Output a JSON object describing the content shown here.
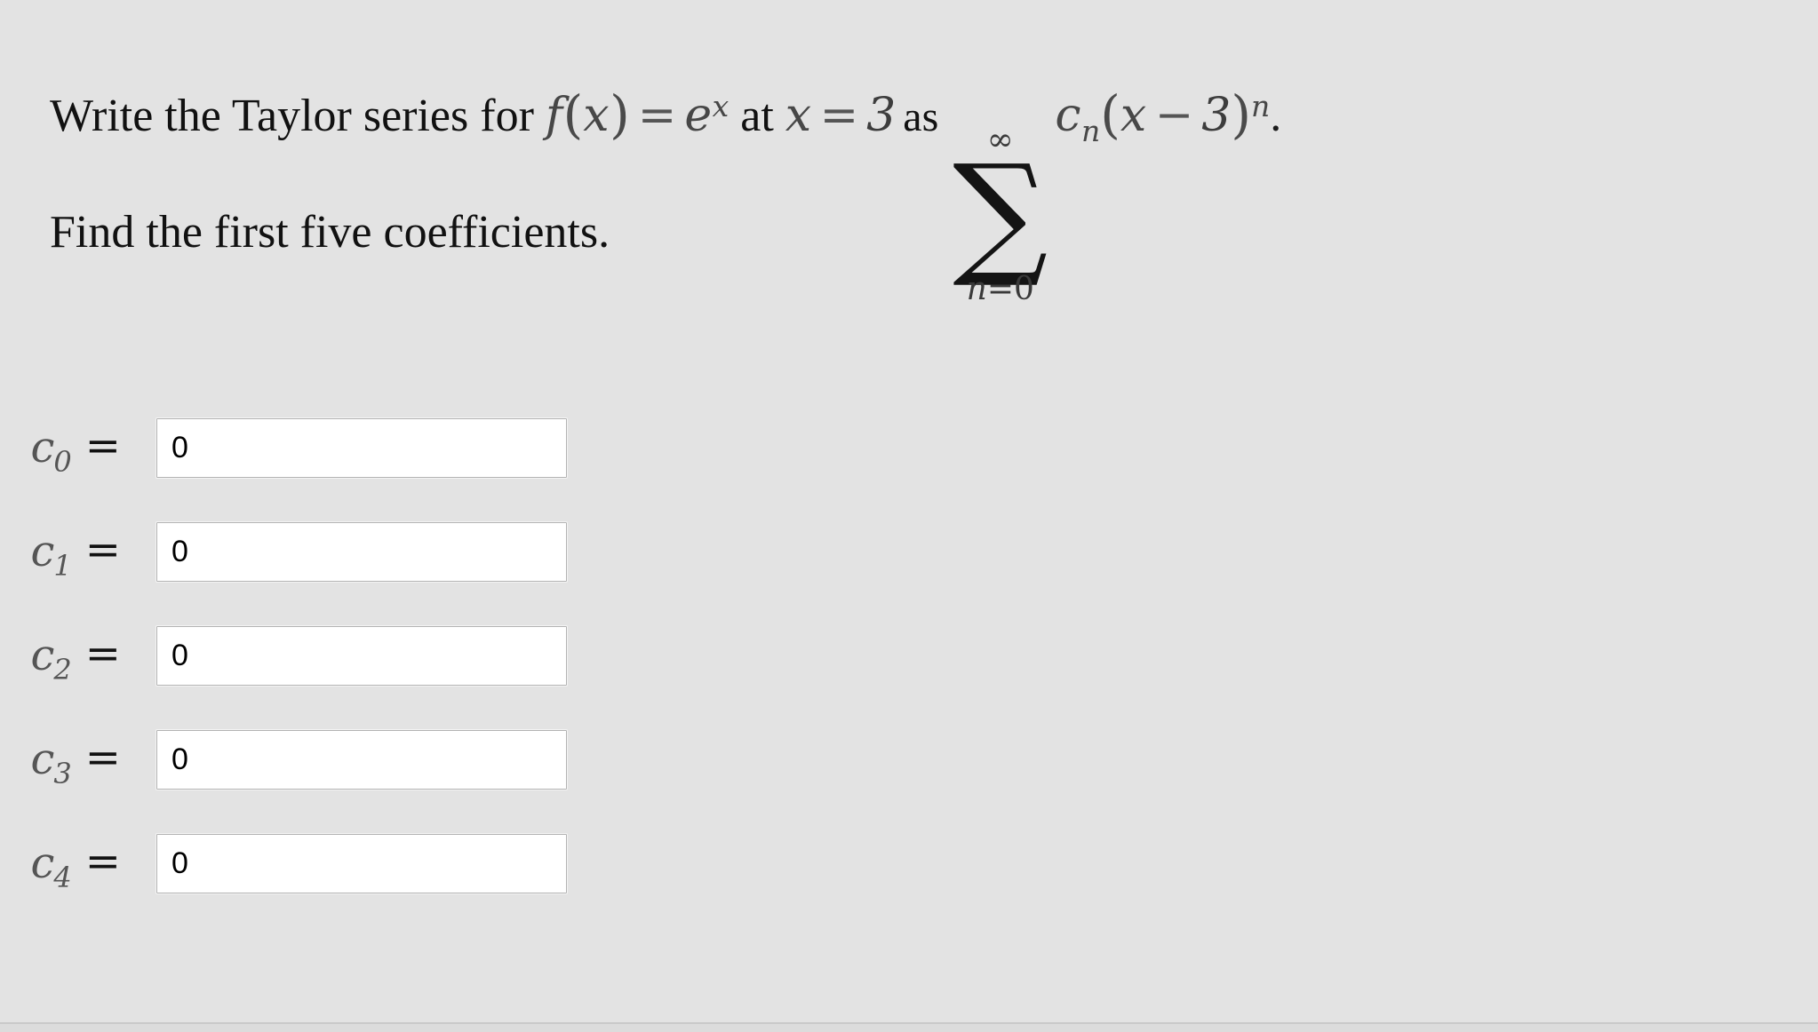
{
  "page": {
    "background_color": "#e3e3e3",
    "text_color": "#111111"
  },
  "problem": {
    "line1": {
      "lead_text": "Write the Taylor series for",
      "function_f": "f",
      "paren_open": "(",
      "var_x": "x",
      "paren_close": ")",
      "equals": "=",
      "exp_base": "e",
      "exp_power": "x",
      "at_text": "at",
      "var_x2": "x",
      "equals2": "=",
      "center_value": "3",
      "as_text": "as",
      "sum_upper_limit": "∞",
      "sum_symbol": "∑",
      "sum_lower_index": "n",
      "sum_lower_equals": "=",
      "sum_lower_value": "0",
      "coef_c": "c",
      "coef_sub_n": "n",
      "term_paren_open": "(",
      "term_var": "x",
      "term_minus": "−",
      "term_value": "3",
      "term_paren_close": ")",
      "term_power": "n",
      "period": "."
    },
    "line2": {
      "text": "Find the first five coefficients."
    }
  },
  "coefficients": {
    "rows": [
      {
        "symbol": "c",
        "index": "0",
        "equals": "=",
        "value": "0",
        "placeholder": ""
      },
      {
        "symbol": "c",
        "index": "1",
        "equals": "=",
        "value": "0",
        "placeholder": ""
      },
      {
        "symbol": "c",
        "index": "2",
        "equals": "=",
        "value": "0",
        "placeholder": ""
      },
      {
        "symbol": "c",
        "index": "3",
        "equals": "=",
        "value": "0",
        "placeholder": ""
      },
      {
        "symbol": "c",
        "index": "4",
        "equals": "=",
        "value": "0",
        "placeholder": ""
      }
    ]
  }
}
